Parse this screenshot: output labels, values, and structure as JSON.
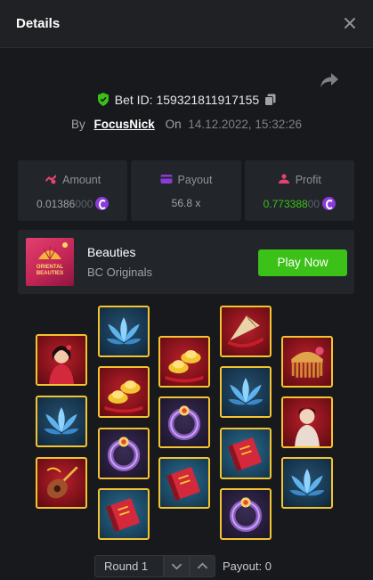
{
  "header": {
    "title": "Details"
  },
  "bet": {
    "id_text": "Bet ID: 159321811917155",
    "by_label": "By",
    "user": "FocusNick",
    "on_label": "On",
    "date": "14.12.2022, 15:32:26"
  },
  "stats": {
    "amount": {
      "label": "Amount",
      "value_main": "0.01386",
      "value_dim": "000"
    },
    "payout": {
      "label": "Payout",
      "value": "56.8 x"
    },
    "profit": {
      "label": "Profit",
      "value_main": "0.773388",
      "value_dim": "00"
    }
  },
  "game": {
    "name": "Beauties",
    "provider": "BC Originals",
    "play_label": "Play Now",
    "thumb_text": "ORIENTAL BEAUTIES"
  },
  "reels": [
    [
      "lady",
      "blue-lotus",
      "fan-instrument"
    ],
    [
      "blue-lotus",
      "gold-ingots",
      "jade-bracelet",
      "red-book"
    ],
    [
      "gold-ingots",
      "jade-bracelet",
      "red-book"
    ],
    [
      "paper-fan",
      "blue-lotus",
      "red-book",
      "jade-bracelet"
    ],
    [
      "comb",
      "lady-2",
      "blue-lotus"
    ]
  ],
  "footer": {
    "round_label": "Round 1",
    "payout_label": "Payout: 0"
  },
  "colors": {
    "accent_green": "#3bc117",
    "tile_border": "#f4c430",
    "coin_purple": "#8b3bd9",
    "background": "#17191c"
  }
}
